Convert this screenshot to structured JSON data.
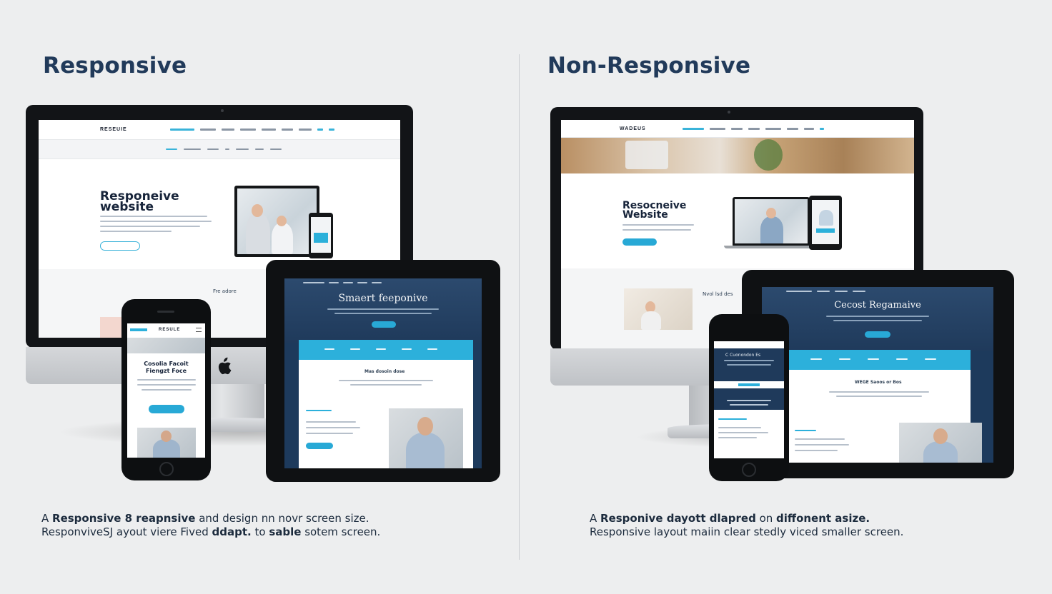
{
  "left_panel": {
    "title": "Responsive",
    "caption_line1_prefix": "A ",
    "caption_line1_bold": "Responsive 8 reapnsive",
    "caption_line1_rest": " and design nn novr screen size.",
    "caption_line2_prefix": "Responvive",
    "caption_line2_bold": "SJ",
    "caption_line2_mid": " ayout viere Fived ",
    "caption_line2_bold2": "ddapt.",
    "caption_line2_rest": " to ",
    "caption_line2_bold3": "sable",
    "caption_line2_end": " sotem screen.",
    "monitor_logo": "RESEUIE",
    "monitor_hero_title_line1": "Responeive",
    "monitor_hero_title_line2": "website",
    "monitor_side_label": "Fre adore",
    "tablet_hero_title": "Smaert feeponive",
    "tablet_section_title": "Mas dosoin dose",
    "phone_logo": "RESULE",
    "phone_heading_line1": "Cosolia Facoit",
    "phone_heading_line2": "Fiengzt Foce"
  },
  "right_panel": {
    "title": "Non-Responsive",
    "caption_line1_prefix": "A ",
    "caption_line1_bold": "Responive dayott dlapred",
    "caption_line1_mid": " on ",
    "caption_line1_bold2": "diffonent asize.",
    "caption_line2": "Responsive layout maiin clear stedly viced smaller screen.",
    "monitor_logo": "WADEUS",
    "monitor_hero_title_line1": "Resocneive",
    "monitor_hero_title_line2": "Website",
    "monitor_side_label": "Nvol lsd des",
    "tablet_hero_title": "Cecost Regamaive",
    "tablet_section_title": "WEGE Saoos or Bos",
    "phone_heading": "C Cuonondon Es"
  },
  "colors": {
    "background": "#edeeef",
    "title": "#213a5a",
    "accent_cyan": "#2cb0db",
    "navy": "#1f3a5b"
  },
  "icons": {
    "brand_logo": "apple-logo-icon"
  }
}
